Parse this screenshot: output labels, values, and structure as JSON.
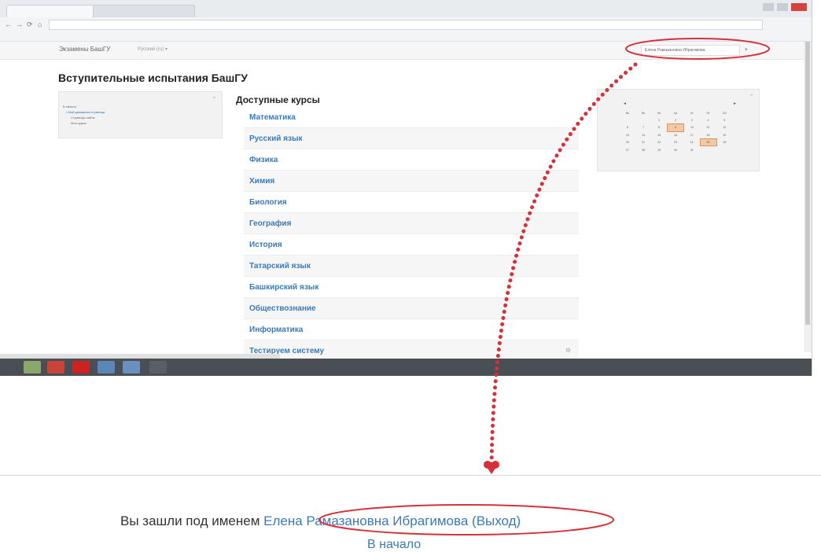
{
  "site": {
    "brand": "Экзамены БашГУ",
    "lang_menu": "Русский (ru) ▾",
    "user_menu": "Елена Рамазановна Ибрагимова"
  },
  "page_title": "Вступительные испытания БашГУ",
  "nav_block": {
    "items": [
      "В начало",
      "• Мой домашняя страница",
      "Страницы сайта",
      "Мои курсы"
    ]
  },
  "courses": {
    "heading": "Доступные курсы",
    "items": [
      "Математика",
      "Русский язык",
      "Физика",
      "Химия",
      "Биология",
      "География",
      "История",
      "Татарский язык",
      "Башкирский язык",
      "Обществознание",
      "Информатика",
      "Тестируем систему"
    ]
  },
  "calendar": {
    "days": [
      "Вс",
      "Пн",
      "Вт",
      "Ср",
      "Чт",
      "Пт",
      "Сб"
    ],
    "weeks": [
      [
        "",
        "",
        "1",
        "2",
        "3",
        "4",
        "5"
      ],
      [
        "6",
        "7",
        "8",
        "9",
        "10",
        "11",
        "12"
      ],
      [
        "13",
        "14",
        "15",
        "16",
        "17",
        "18",
        "19"
      ],
      [
        "20",
        "21",
        "22",
        "23",
        "24",
        "25",
        "26"
      ],
      [
        "27",
        "28",
        "29",
        "30",
        "31",
        "",
        ""
      ]
    ]
  },
  "footer": {
    "login_prefix": "Вы зашли под именем ",
    "user_name": "Елена Рамазановна Ибрагимова",
    "logout": "(Выход)",
    "home": "В начало"
  },
  "colors": {
    "link": "#3a7ab8",
    "annotation": "#d6303a",
    "taskbar": "#4a4f55"
  }
}
